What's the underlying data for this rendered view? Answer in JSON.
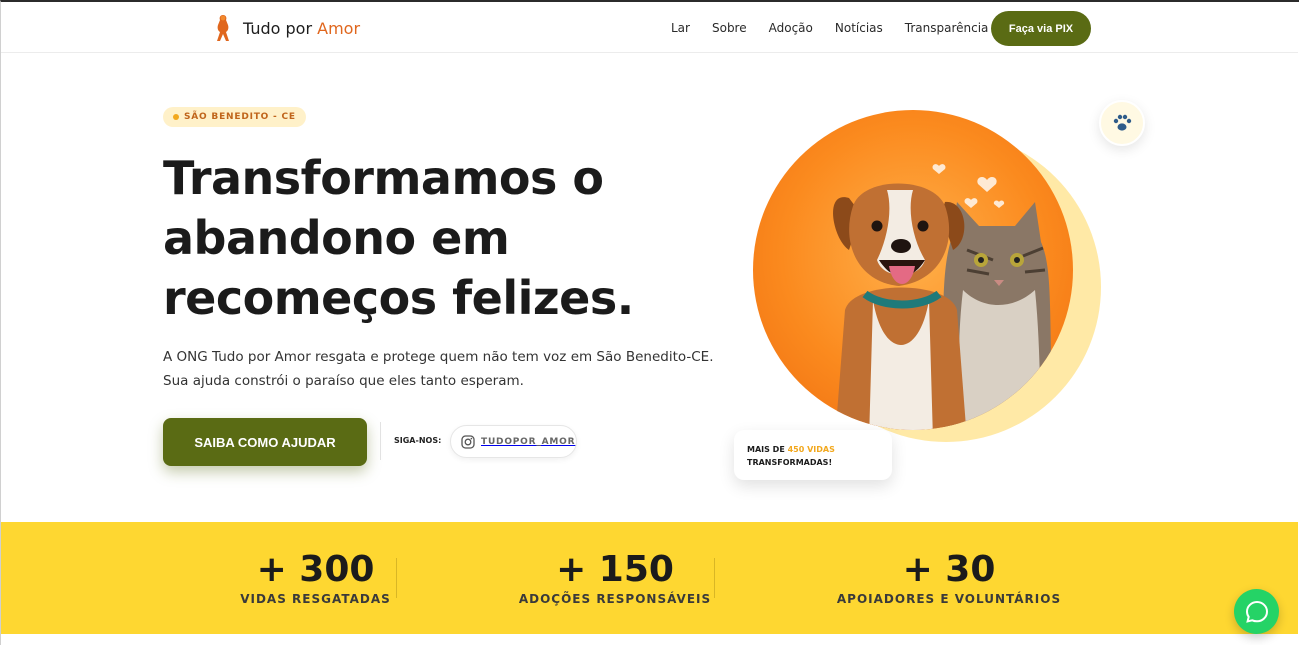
{
  "brand": {
    "name_part1": "Tudo por ",
    "name_part2": "Amor",
    "accent_color": "#e0671e"
  },
  "nav": {
    "items": [
      "Lar",
      "Sobre",
      "Adoção",
      "Notícias",
      "Transparência"
    ],
    "cta_label": "Faça via PIX"
  },
  "hero": {
    "badge": "SÃO BENEDITO - CE",
    "title": "Transformamos o abandono em recomeços felizes.",
    "description": "A ONG Tudo por Amor resgata e protege quem não tem voz em São Benedito-CE. Sua ajuda constrói o paraíso que eles tanto esperam.",
    "cta_label": "SAIBA COMO AJUDAR",
    "follow_label": "SIGA-NOS:",
    "instagram_handle": "TUDOPOR_AMOR",
    "lives_card": {
      "prefix": "MAIS DE ",
      "highlight": "450 VIDAS",
      "suffix": "TRANSFORMADAS!"
    }
  },
  "stats": [
    {
      "value": "+ 300",
      "label": "VIDAS RESGATADAS"
    },
    {
      "value": "+ 150",
      "label": "ADOÇÕES RESPONSÁVEIS"
    },
    {
      "value": "+ 30",
      "label": "APOIADORES E VOLUNTÁRIOS"
    }
  ],
  "colors": {
    "primary": "#5a6b14",
    "yellow": "#fed731",
    "orange": "#fb8a1e",
    "whatsapp": "#25d366"
  },
  "icons": [
    "logo-icon",
    "instagram-icon",
    "paw-icon",
    "whatsapp-icon"
  ]
}
